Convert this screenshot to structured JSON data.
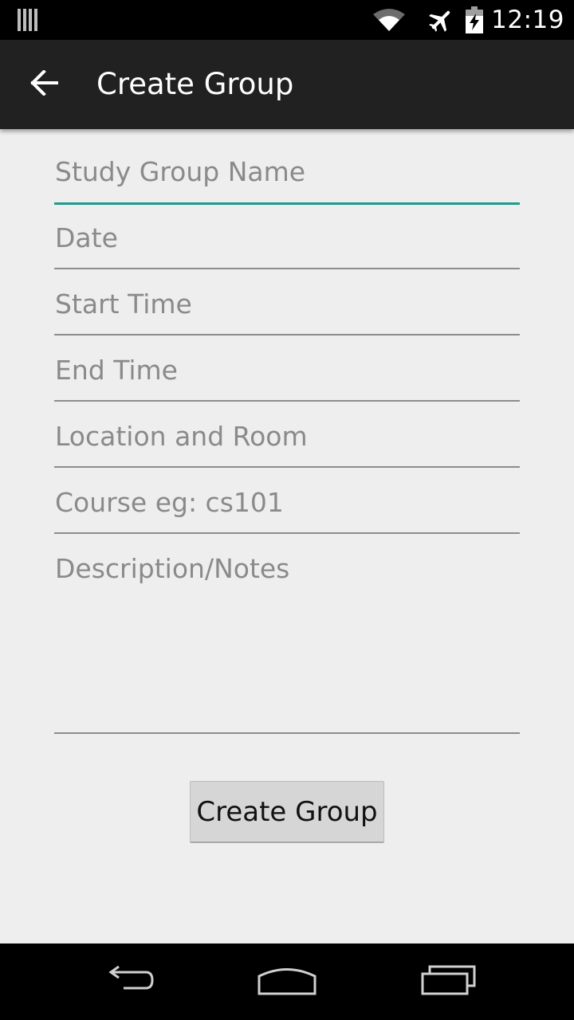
{
  "status_bar": {
    "time": "12:19",
    "icons": [
      "notification-bars-icon",
      "wifi-icon",
      "airplane-icon",
      "battery-charging-icon"
    ]
  },
  "app_bar": {
    "title": "Create Group",
    "back_icon": "arrow-back-icon"
  },
  "form": {
    "fields": [
      {
        "placeholder": "Study Group Name",
        "value": ""
      },
      {
        "placeholder": "Date",
        "value": ""
      },
      {
        "placeholder": "Start Time",
        "value": ""
      },
      {
        "placeholder": "End Time",
        "value": ""
      },
      {
        "placeholder": "Location and Room",
        "value": ""
      },
      {
        "placeholder": "Course eg: cs101",
        "value": ""
      },
      {
        "placeholder": "Description/Notes",
        "value": ""
      }
    ],
    "submit_label": "Create Group"
  },
  "nav_bar": {
    "icons": [
      "back-nav-icon",
      "home-nav-icon",
      "recents-nav-icon"
    ]
  },
  "colors": {
    "accent": "#1e9c8e",
    "app_bar": "#212121",
    "background": "#eeeeee"
  }
}
